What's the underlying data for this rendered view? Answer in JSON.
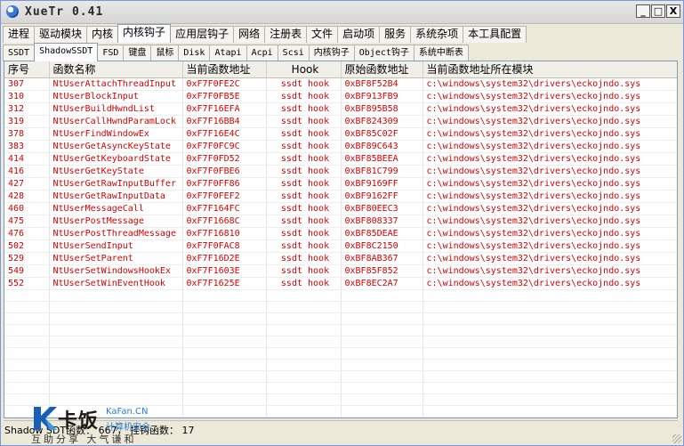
{
  "window": {
    "title": "XueTr 0.41",
    "controls": {
      "minimize": "_",
      "maximize": "□",
      "close": "X"
    }
  },
  "main_tabs": [
    {
      "label": "进程"
    },
    {
      "label": "驱动模块"
    },
    {
      "label": "内核"
    },
    {
      "label": "内核钩子",
      "active": true
    },
    {
      "label": "应用层钩子"
    },
    {
      "label": "网络"
    },
    {
      "label": "注册表"
    },
    {
      "label": "文件"
    },
    {
      "label": "启动项"
    },
    {
      "label": "服务"
    },
    {
      "label": "系统杂项"
    },
    {
      "label": "本工具配置"
    }
  ],
  "sub_tabs": [
    {
      "label": "SSDT"
    },
    {
      "label": "ShadowSSDT",
      "active": true
    },
    {
      "label": "FSD"
    },
    {
      "label": "键盘"
    },
    {
      "label": "鼠标"
    },
    {
      "label": "Disk"
    },
    {
      "label": "Atapi"
    },
    {
      "label": "Acpi"
    },
    {
      "label": "Scsi"
    },
    {
      "label": "内核钩子"
    },
    {
      "label": "Object钩子"
    },
    {
      "label": "系统中断表"
    }
  ],
  "table": {
    "columns": [
      "序号",
      "函数名称",
      "当前函数地址",
      "Hook",
      "原始函数地址",
      "当前函数地址所在模块"
    ],
    "rows": [
      [
        "307",
        "NtUserAttachThreadInput",
        "0xF7F0FE2C",
        "ssdt hook",
        "0xBF8F52B4",
        "c:\\windows\\system32\\drivers\\eckojndo.sys"
      ],
      [
        "310",
        "NtUserBlockInput",
        "0xF7F0FB5E",
        "ssdt hook",
        "0xBF913FB9",
        "c:\\windows\\system32\\drivers\\eckojndo.sys"
      ],
      [
        "312",
        "NtUserBuildHwndList",
        "0xF7F16EFA",
        "ssdt hook",
        "0xBF895B58",
        "c:\\windows\\system32\\drivers\\eckojndo.sys"
      ],
      [
        "319",
        "NtUserCallHwndParamLock",
        "0xF7F16BB4",
        "ssdt hook",
        "0xBF824309",
        "c:\\windows\\system32\\drivers\\eckojndo.sys"
      ],
      [
        "378",
        "NtUserFindWindowEx",
        "0xF7F16E4C",
        "ssdt hook",
        "0xBF85C02F",
        "c:\\windows\\system32\\drivers\\eckojndo.sys"
      ],
      [
        "383",
        "NtUserGetAsyncKeyState",
        "0xF7F0FC9C",
        "ssdt hook",
        "0xBF89C643",
        "c:\\windows\\system32\\drivers\\eckojndo.sys"
      ],
      [
        "414",
        "NtUserGetKeyboardState",
        "0xF7F0FD52",
        "ssdt hook",
        "0xBF85BEEA",
        "c:\\windows\\system32\\drivers\\eckojndo.sys"
      ],
      [
        "416",
        "NtUserGetKeyState",
        "0xF7F0FBE6",
        "ssdt hook",
        "0xBF81C799",
        "c:\\windows\\system32\\drivers\\eckojndo.sys"
      ],
      [
        "427",
        "NtUserGetRawInputBuffer",
        "0xF7F0FF86",
        "ssdt hook",
        "0xBF9169FF",
        "c:\\windows\\system32\\drivers\\eckojndo.sys"
      ],
      [
        "428",
        "NtUserGetRawInputData",
        "0xF7F0FEF2",
        "ssdt hook",
        "0xBF9162FF",
        "c:\\windows\\system32\\drivers\\eckojndo.sys"
      ],
      [
        "460",
        "NtUserMessageCall",
        "0xF7F164FC",
        "ssdt hook",
        "0xBF80EEC3",
        "c:\\windows\\system32\\drivers\\eckojndo.sys"
      ],
      [
        "475",
        "NtUserPostMessage",
        "0xF7F1668C",
        "ssdt hook",
        "0xBF808337",
        "c:\\windows\\system32\\drivers\\eckojndo.sys"
      ],
      [
        "476",
        "NtUserPostThreadMessage",
        "0xF7F16810",
        "ssdt hook",
        "0xBF85DEAE",
        "c:\\windows\\system32\\drivers\\eckojndo.sys"
      ],
      [
        "502",
        "NtUserSendInput",
        "0xF7F0FAC8",
        "ssdt hook",
        "0xBF8C2150",
        "c:\\windows\\system32\\drivers\\eckojndo.sys"
      ],
      [
        "529",
        "NtUserSetParent",
        "0xF7F16D2E",
        "ssdt hook",
        "0xBF8AB367",
        "c:\\windows\\system32\\drivers\\eckojndo.sys"
      ],
      [
        "549",
        "NtUserSetWindowsHookEx",
        "0xF7F1603E",
        "ssdt hook",
        "0xBF85F852",
        "c:\\windows\\system32\\drivers\\eckojndo.sys"
      ],
      [
        "552",
        "NtUserSetWinEventHook",
        "0xF7F1625E",
        "ssdt hook",
        "0xBF8EC2A7",
        "c:\\windows\\system32\\drivers\\eckojndo.sys"
      ]
    ]
  },
  "status": {
    "text": "Shadow SDT函数： 667， 挂钩函数： 17"
  },
  "watermark": {
    "brand": "卡饭",
    "site": "KaFan.CN",
    "sub": "计算机安全",
    "slogan": "互助分享 大气谦和"
  },
  "colors": {
    "hooked_row_text": "#d40000",
    "window_bg": "#ece9d8",
    "watermark_blue": "#2a7bd5"
  }
}
